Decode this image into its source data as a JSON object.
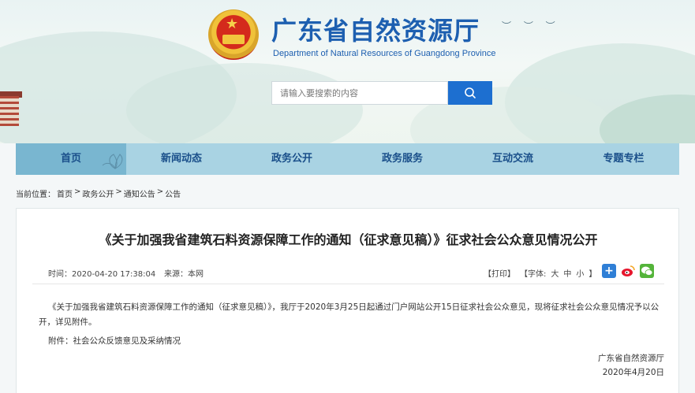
{
  "site": {
    "title": "广东省自然资源厅",
    "subtitle": "Department of Natural Resources of Guangdong Province"
  },
  "search": {
    "placeholder": "请输入要搜索的内容",
    "value": ""
  },
  "nav": {
    "items": [
      {
        "label": "首页",
        "active": true
      },
      {
        "label": "新闻动态"
      },
      {
        "label": "政务公开"
      },
      {
        "label": "政务服务"
      },
      {
        "label": "互动交流"
      },
      {
        "label": "专题专栏"
      }
    ]
  },
  "breadcrumb": {
    "prefix": "当前位置：",
    "items": [
      "首页",
      "政务公开",
      "通知公告",
      "公告"
    ],
    "separator": ">"
  },
  "article": {
    "title": "《关于加强我省建筑石料资源保障工作的通知（征求意见稿）》征求社会公众意见情况公开",
    "time": "时间：2020-04-20 17:38:04",
    "source": "来源：本网",
    "print": "【打印】",
    "font_label": "【字体:",
    "font_large": "大",
    "font_medium": "中",
    "font_small": "小",
    "font_close": "】",
    "body": "《关于加强我省建筑石料资源保障工作的通知（征求意见稿）》，我厅于2020年3月25日起通过门户网站公开15日征求社会公众意见，现将征求社会公众意见情况予以公开，详见附件。",
    "attachment": "附件：社会公众反馈意见及采纳情况",
    "signature_org": "广东省自然资源厅",
    "signature_date": "2020年4月20日"
  },
  "colors": {
    "brand_blue": "#1d5fb0",
    "nav_bg": "#a9d3e3",
    "nav_active": "#79b6d0",
    "search_button": "#1d6fd0"
  },
  "icons": [
    "emblem-icon",
    "search-icon",
    "share-plus-icon",
    "weibo-icon",
    "wechat-icon",
    "flower-icon"
  ]
}
